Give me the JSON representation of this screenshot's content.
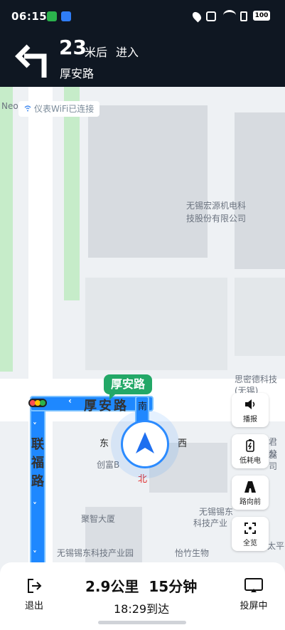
{
  "status": {
    "time": "06:15",
    "battery": "100"
  },
  "banner": {
    "distance_value": "23",
    "distance_unit": "米后",
    "action": "进入",
    "road": "厚安路"
  },
  "map": {
    "wifi_chip": "仪表WiFi已连接",
    "poi_company1_line1": "无锡宏源机电科",
    "poi_company1_line2": "技股份有限公司",
    "poi_sides": "思密德科技",
    "poi_sides2": "(无锡)",
    "poi_chuangfu": "创富B",
    "poi_jjxds": "聚智大厦",
    "poi_wuxi_keji_line1": "无锡锡东",
    "poi_wuxi_keji_line2": "科技产业",
    "poi_wxxd_park": "无锡锡东科技产业园",
    "poi_yizhu": "怡竹生物",
    "poi_junlei1": "君磊",
    "poi_junlei2": "公司",
    "poi_taiping": "太平",
    "road_vertical": [
      "联",
      "福",
      "路"
    ],
    "road_horizontal": "厚安路",
    "road_bubble": "厚安路",
    "compass": {
      "south": "南",
      "north": "北",
      "east": "东",
      "west": "西"
    },
    "neo_label": "Neo"
  },
  "side_buttons": {
    "broadcast": "播报",
    "low_power": "低耗电",
    "route_ahead": "路向前",
    "overview": "全览"
  },
  "bottom": {
    "exit_label": "退出",
    "distance": "2.9公里",
    "duration": "15分钟",
    "eta": "18:29到达",
    "cast_label": "投屏中"
  },
  "colors": {
    "route": "#1e88ff",
    "bubble": "#23a867",
    "banner_bg": "#0f1722"
  }
}
